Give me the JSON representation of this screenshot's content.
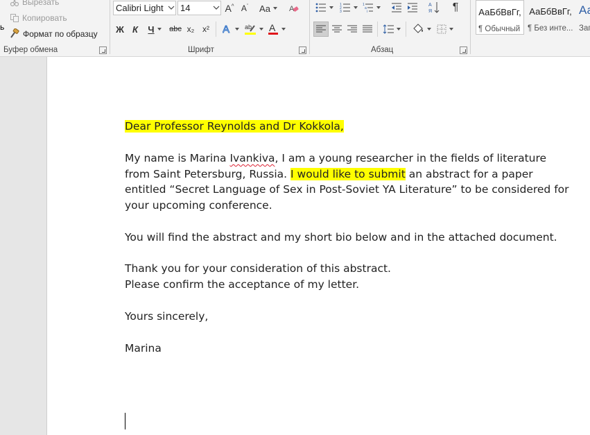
{
  "ribbon": {
    "clipboard": {
      "cut": "Вырезать",
      "copy": "Копировать",
      "format_painter": "Формат по образцу",
      "paste_fragment": "ь",
      "group_label": "Буфер обмена"
    },
    "font": {
      "font_name": "Calibri Light",
      "font_size": "14",
      "change_case": "Aa",
      "bold": "Ж",
      "italic": "К",
      "underline": "Ч",
      "strike": "abc",
      "subscript": "x₂",
      "superscript": "x²",
      "group_label": "Шрифт"
    },
    "paragraph": {
      "pilcrow": "¶",
      "group_label": "Абзац"
    },
    "styles": [
      {
        "sample": "АаБбВвГг,",
        "name": "¶ Обычный"
      },
      {
        "sample": "АаБбВвГг,",
        "name": "¶ Без инте..."
      },
      {
        "sample": "Аа",
        "name": "Заг"
      }
    ]
  },
  "document": {
    "salutation": "Dear Professor Reynolds and Dr Kokkola,",
    "p1": {
      "line1_pre": "My name is Marina ",
      "line1_misspelled": "Ivankiva",
      "line1_post": ", I am a young researcher in the fields of literature",
      "line2_pre": "from Saint Petersburg, Russia. ",
      "line2_highlight": "I would like to submit",
      "line2_post": " an abstract for a paper",
      "line3": "entitled “Secret Language of Sex in Post-Soviet YA Literature” to be considered for",
      "line4": "your upcoming conference."
    },
    "p2": "You will find the abstract and my short bio below and in the attached document.",
    "p3_line1": "Thank you for your consideration of this abstract.",
    "p3_line2": "Please confirm the acceptance of my letter.",
    "closing": "Yours sincerely,",
    "signature": "Marina"
  },
  "colors": {
    "highlight": "#ffff00",
    "font_color_bar": "#e0161b",
    "highlight_bar": "#ffff00"
  }
}
